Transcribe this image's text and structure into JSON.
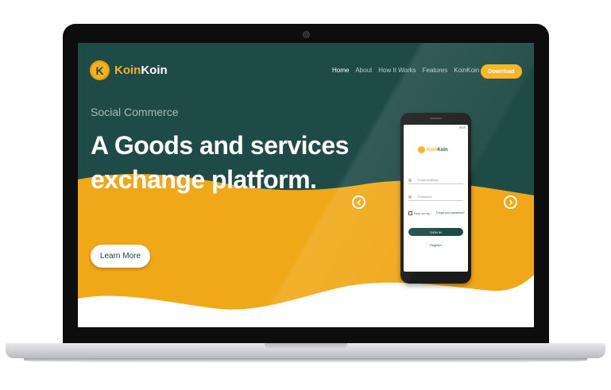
{
  "colors": {
    "teal": "#1e4b47",
    "yellow": "#f0a818",
    "white": "#ffffff",
    "accent": "#f5b31b"
  },
  "header": {
    "logo_part1": "Koin",
    "logo_part2": "Koin",
    "logo_mark": "K",
    "nav": [
      {
        "label": "Home",
        "active": true
      },
      {
        "label": "About",
        "active": false
      },
      {
        "label": "How It Works",
        "active": false
      },
      {
        "label": "Features",
        "active": false
      },
      {
        "label": "KoinKoin",
        "active": false
      }
    ],
    "download_label": "Download"
  },
  "hero": {
    "subtitle": "Social Commerce",
    "headline": "A Goods and services exchange platform.",
    "cta_label": "Learn More",
    "prev_icon": "chevron-left-icon",
    "next_icon": "chevron-right-icon"
  },
  "phone": {
    "skip_label": "SKIP",
    "logo_part1": "Koin",
    "logo_part2": "Koin",
    "email_placeholder": "Email Address",
    "password_placeholder": "Password",
    "remember_label": "Keep me sig...",
    "forgot_label": "Forgot your password?",
    "signin_label": "SIGN IN",
    "register_label": "Register"
  }
}
